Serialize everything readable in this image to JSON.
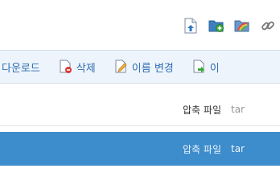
{
  "toolbar": {
    "icons": [
      "upload-icon",
      "new-folder-icon",
      "folder-color-icon",
      "link-icon"
    ]
  },
  "actions": [
    {
      "label": "다운로드",
      "icon": ""
    },
    {
      "label": "삭제",
      "icon": "delete-file-icon"
    },
    {
      "label": "이름 변경",
      "icon": "rename-file-icon"
    },
    {
      "label": "이",
      "icon": "move-file-icon"
    }
  ],
  "rows": [
    {
      "type": "압축 파일",
      "ext": "tar",
      "selected": false
    },
    {
      "type": "압축 파일",
      "ext": "tar",
      "selected": true
    }
  ],
  "colors": {
    "selected_row": "#3d8ccc",
    "action_text": "#2d6db3",
    "action_bar_bg": "#eef4fb"
  }
}
